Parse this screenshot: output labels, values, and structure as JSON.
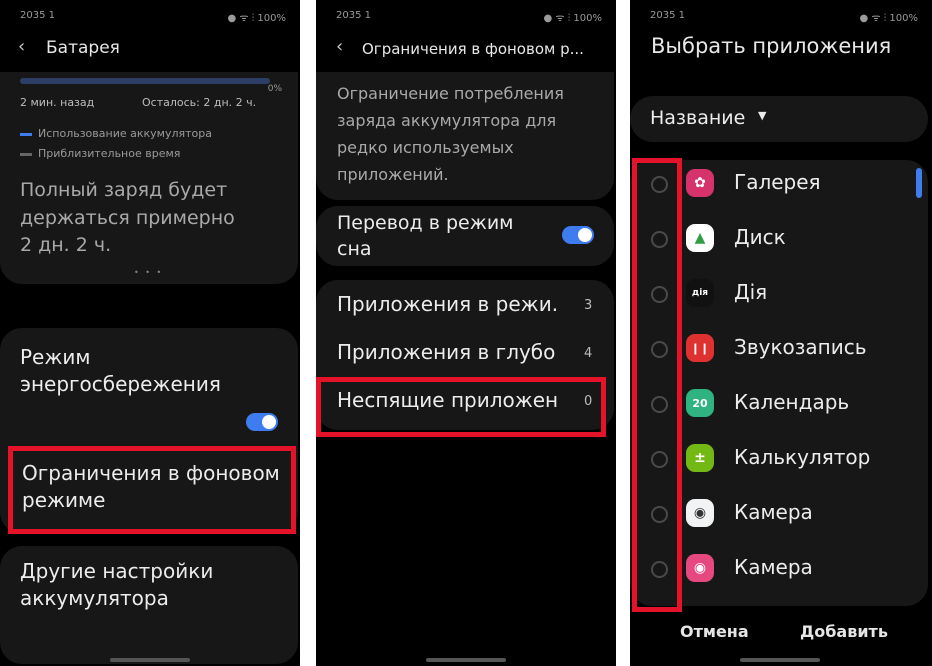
{
  "screen1": {
    "status_time": "2035 1",
    "status_icons": "● ᯤ ⫶ 100%",
    "title": "Батарея",
    "battery_percent": "0%",
    "time_ago": "2 мин. назад",
    "remaining": "Осталось: 2 дн. 2 ч.",
    "legend": [
      "Использование аккумулятора",
      "Приблизительное время"
    ],
    "full_charge_text": "Полный заряд будет держаться примерно",
    "full_charge_value": "2 дн. 2 ч.",
    "page_dots": "• • •",
    "power_saving_label": "Режим энергосбережения",
    "power_saving_on": true,
    "background_limits_label": "Ограничения в фоновом режиме",
    "other_settings_label": "Другие настройки аккумулятора"
  },
  "screen2": {
    "status_time": "2035 1",
    "status_icons": "● ᯤ ⫶ 100%",
    "title": "Ограничения в фоновом р...",
    "description": "Ограничение потребления заряда аккумулятора для редко используемых приложений.",
    "sleep_mode_label": "Перевод в режим сна",
    "sleep_mode_on": true,
    "items": [
      {
        "label": "Приложения в режи...",
        "count": "3"
      },
      {
        "label": "Приложения в глубо...",
        "count": "4"
      },
      {
        "label": "Неспящие приложен...",
        "count": "0"
      }
    ]
  },
  "screen3": {
    "status_time": "2035 1",
    "status_icons": "● ᯤ ⫶ 100%",
    "title": "Выбрать приложения",
    "sort_label": "Название",
    "apps": [
      {
        "name": "Галерея",
        "icon": "flower-icon",
        "color": "#d6336c",
        "glyph": "✿"
      },
      {
        "name": "Диск",
        "icon": "drive-icon",
        "color": "#ffffff",
        "glyph": "▲"
      },
      {
        "name": "Дія",
        "icon": "diia-icon",
        "color": "#111111",
        "glyph": "дія"
      },
      {
        "name": "Звукозапись",
        "icon": "microphone-icon",
        "color": "#e03131",
        "glyph": "❙❙"
      },
      {
        "name": "Календарь",
        "icon": "calendar-icon",
        "color": "#2fb380",
        "glyph": "20"
      },
      {
        "name": "Калькулятор",
        "icon": "calculator-icon",
        "color": "#74b816",
        "glyph": "±"
      },
      {
        "name": "Камера",
        "icon": "camera-icon",
        "color": "#f1f3f5",
        "glyph": "◉"
      },
      {
        "name": "Камера",
        "icon": "camera-icon",
        "color": "#e64980",
        "glyph": "◉"
      }
    ],
    "cancel_label": "Отмена",
    "add_label": "Добавить"
  },
  "colors": {
    "highlight": "#e5132a",
    "toggle_on": "#3f7cf0",
    "card": "#171717"
  }
}
